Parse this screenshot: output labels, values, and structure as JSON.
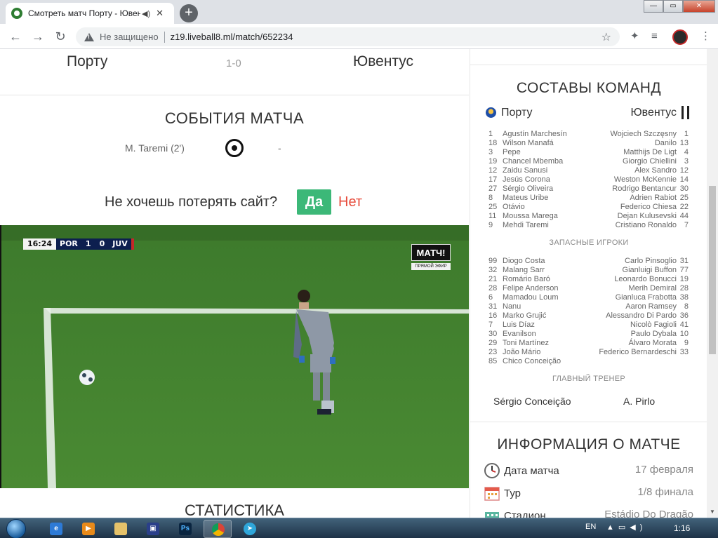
{
  "browser": {
    "tab_title": "Смотреть матч Порту - Ювентус",
    "new_tab": "+",
    "insecure_label": "Не защищено",
    "url": "z19.liveball8.ml/match/652234",
    "window_controls": {
      "minimize": "—",
      "maximize": "▭",
      "close": "✕"
    }
  },
  "match": {
    "home": "Порту",
    "away": "Ювентус",
    "score": "1-0"
  },
  "events": {
    "title": "СОБЫТИЯ МАТЧА",
    "items": [
      {
        "player": "M. Taremi (2')",
        "away": "-"
      }
    ]
  },
  "prompt": {
    "text": "Не хочешь потерять сайт?",
    "yes": "Да",
    "no": "Нет"
  },
  "video": {
    "clock": "16:24",
    "home_abbr": "POR",
    "home_score": "1",
    "away_score": "0",
    "away_abbr": "JUV",
    "channel": "МАТЧ!",
    "channel_sub": "ПРЯМОЙ ЭФИР"
  },
  "stats_title": "СТАТИСТИКА",
  "lineups": {
    "title": "СОСТАВЫ КОМАНД",
    "home": "Порту",
    "away": "Ювентус",
    "starters_home": [
      {
        "n": "1",
        "name": "Agustín Marchesín"
      },
      {
        "n": "18",
        "name": "Wilson Manafá"
      },
      {
        "n": "3",
        "name": "Pepe"
      },
      {
        "n": "19",
        "name": "Chancel Mbemba"
      },
      {
        "n": "12",
        "name": "Zaidu Sanusi"
      },
      {
        "n": "17",
        "name": "Jesús Corona"
      },
      {
        "n": "27",
        "name": "Sérgio Oliveira"
      },
      {
        "n": "8",
        "name": "Mateus Uribe"
      },
      {
        "n": "25",
        "name": "Otávio"
      },
      {
        "n": "11",
        "name": "Moussa Marega"
      },
      {
        "n": "9",
        "name": "Mehdi Taremi"
      }
    ],
    "starters_away": [
      {
        "n": "1",
        "name": "Wojciech Szczęsny"
      },
      {
        "n": "13",
        "name": "Danilo"
      },
      {
        "n": "4",
        "name": "Matthijs De Ligt"
      },
      {
        "n": "3",
        "name": "Giorgio Chiellini"
      },
      {
        "n": "12",
        "name": "Alex Sandro"
      },
      {
        "n": "14",
        "name": "Weston McKennie"
      },
      {
        "n": "30",
        "name": "Rodrigo Bentancur"
      },
      {
        "n": "25",
        "name": "Adrien Rabiot"
      },
      {
        "n": "22",
        "name": "Federico Chiesa"
      },
      {
        "n": "44",
        "name": "Dejan Kulusevski"
      },
      {
        "n": "7",
        "name": "Cristiano Ronaldo"
      }
    ],
    "subs_title": "ЗАПАСНЫЕ ИГРОКИ",
    "subs_home": [
      {
        "n": "99",
        "name": "Diogo Costa"
      },
      {
        "n": "32",
        "name": "Malang Sarr"
      },
      {
        "n": "21",
        "name": "Romário Baró"
      },
      {
        "n": "28",
        "name": "Felipe Anderson"
      },
      {
        "n": "6",
        "name": "Mamadou Loum"
      },
      {
        "n": "31",
        "name": "Nanu"
      },
      {
        "n": "16",
        "name": "Marko Grujić"
      },
      {
        "n": "7",
        "name": "Luis Díaz"
      },
      {
        "n": "30",
        "name": "Evanilson"
      },
      {
        "n": "29",
        "name": "Toni Martínez"
      },
      {
        "n": "23",
        "name": "João Mário"
      },
      {
        "n": "85",
        "name": "Chico Conceição"
      }
    ],
    "subs_away": [
      {
        "n": "31",
        "name": "Carlo Pinsoglio"
      },
      {
        "n": "77",
        "name": "Gianluigi Buffon"
      },
      {
        "n": "19",
        "name": "Leonardo Bonucci"
      },
      {
        "n": "28",
        "name": "Merih Demiral"
      },
      {
        "n": "38",
        "name": "Gianluca Frabotta"
      },
      {
        "n": "8",
        "name": "Aaron Ramsey"
      },
      {
        "n": "36",
        "name": "Alessandro Di Pardo"
      },
      {
        "n": "41",
        "name": "Nicolò Fagioli"
      },
      {
        "n": "10",
        "name": "Paulo Dybala"
      },
      {
        "n": "9",
        "name": "Álvaro Morata"
      },
      {
        "n": "33",
        "name": "Federico Bernardeschi"
      }
    ],
    "coach_title": "ГЛАВНЫЙ ТРЕНЕР",
    "coach_home": "Sérgio Conceição",
    "coach_away": "A. Pirlo"
  },
  "info": {
    "title": "ИНФОРМАЦИЯ О МАТЧЕ",
    "rows": [
      {
        "label": "Дата матча",
        "value": "17 февраля",
        "icon": "clock-icon"
      },
      {
        "label": "Тур",
        "value": "1/8 финала",
        "icon": "calendar-icon"
      },
      {
        "label": "Стадион",
        "value": "Estádio Do Dragão",
        "icon": "stadium-icon"
      }
    ]
  },
  "taskbar": {
    "lang": "EN",
    "time": "1:16",
    "ps_label": "Ps"
  }
}
